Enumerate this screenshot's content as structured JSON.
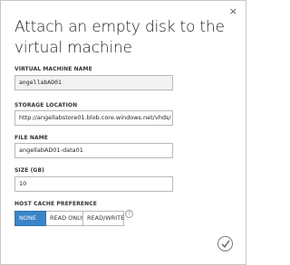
{
  "dialog": {
    "title": "Attach an empty disk to the virtual machine",
    "close_glyph": "×"
  },
  "vm_name": {
    "label": "VIRTUAL MACHINE NAME",
    "value": "angellabAD01"
  },
  "storage_location": {
    "label": "STORAGE LOCATION",
    "value": "http://angellabstore01.blob.core.windows.net/vhds/"
  },
  "file_name": {
    "label": "FILE NAME",
    "value": "angellabAD01-data01"
  },
  "size": {
    "label": "SIZE (GB)",
    "value": "10"
  },
  "host_cache": {
    "label": "HOST CACHE PREFERENCE",
    "options": [
      "NONE",
      "READ ONLY",
      "READ/WRITE"
    ],
    "selected": "NONE",
    "help_glyph": "?"
  },
  "colors": {
    "accent": "#3a85c8"
  }
}
